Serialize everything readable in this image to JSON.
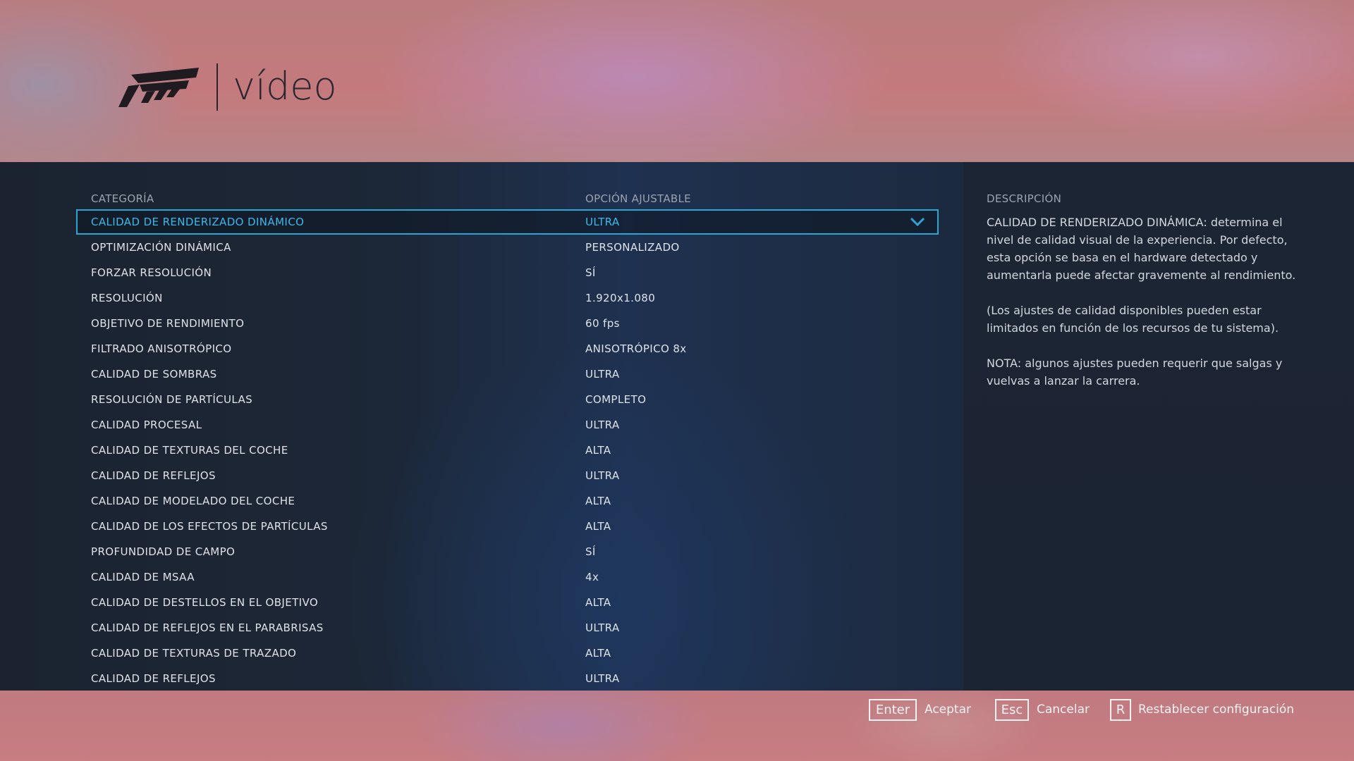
{
  "header": {
    "title": "vídeo"
  },
  "columns": {
    "category": "CATEGORÍA",
    "option": "OPCIÓN AJUSTABLE",
    "description": "DESCRIPCIÓN"
  },
  "settings": [
    {
      "label": "CALIDAD DE RENDERIZADO DINÁMICO",
      "value": "ULTRA"
    },
    {
      "label": "OPTIMIZACIÓN DINÁMICA",
      "value": "PERSONALIZADO"
    },
    {
      "label": "FORZAR RESOLUCIÓN",
      "value": "SÍ"
    },
    {
      "label": "RESOLUCIÓN",
      "value": "1.920x1.080"
    },
    {
      "label": "OBJETIVO DE RENDIMIENTO",
      "value": "60 fps"
    },
    {
      "label": "FILTRADO ANISOTRÓPICO",
      "value": "ANISOTRÓPICO 8x"
    },
    {
      "label": "CALIDAD DE SOMBRAS",
      "value": "ULTRA"
    },
    {
      "label": "RESOLUCIÓN DE PARTÍCULAS",
      "value": "COMPLETO"
    },
    {
      "label": "CALIDAD PROCESAL",
      "value": "ULTRA"
    },
    {
      "label": "CALIDAD DE TEXTURAS DEL COCHE",
      "value": "ALTA"
    },
    {
      "label": "CALIDAD DE REFLEJOS",
      "value": "ULTRA"
    },
    {
      "label": "CALIDAD DE MODELADO DEL COCHE",
      "value": "ALTA"
    },
    {
      "label": "CALIDAD DE LOS EFECTOS DE PARTÍCULAS",
      "value": "ALTA"
    },
    {
      "label": "PROFUNDIDAD DE CAMPO",
      "value": "SÍ"
    },
    {
      "label": "CALIDAD DE MSAA",
      "value": "4x"
    },
    {
      "label": "CALIDAD DE DESTELLOS EN EL OBJETIVO",
      "value": "ALTA"
    },
    {
      "label": "CALIDAD DE REFLEJOS EN EL PARABRISAS",
      "value": "ULTRA"
    },
    {
      "label": "CALIDAD DE TEXTURAS DE TRAZADO",
      "value": "ALTA"
    },
    {
      "label": "CALIDAD DE REFLEJOS",
      "value": "ULTRA"
    }
  ],
  "selected_index": 0,
  "description": {
    "paragraphs": [
      "CALIDAD DE RENDERIZADO DINÁMICA: determina el nivel de calidad visual de la experiencia. Por defecto, esta opción se basa en el hardware detectado y aumentarla puede afectar gravemente al rendimiento.",
      "(Los ajustes de calidad disponibles pueden estar limitados en función de los recursos de tu sistema).",
      "NOTA: algunos ajustes pueden requerir que salgas y vuelvas a lanzar la carrera."
    ]
  },
  "footer": {
    "accept_key": "Enter",
    "accept_label": "Aceptar",
    "cancel_key": "Esc",
    "cancel_label": "Cancelar",
    "reset_key": "R",
    "reset_label": "Restablecer configuración"
  },
  "colors": {
    "accent": "#2aa6d4",
    "header_bg": "#c47a7c"
  },
  "icons": {
    "logo": "forza-logo-icon",
    "dropdown": "chevron-down-icon"
  }
}
